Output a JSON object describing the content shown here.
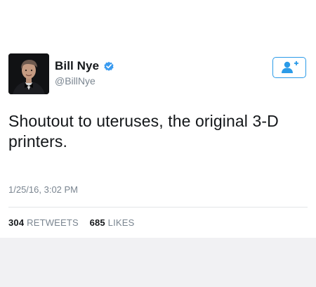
{
  "tweet": {
    "author": {
      "display_name": "Bill Nye",
      "handle": "@BillNye",
      "verified": true
    },
    "text": "Shoutout to uteruses, the original 3-D printers.",
    "timestamp": "1/25/16, 3:02 PM",
    "stats": {
      "retweets_count": "304",
      "retweets_label": "RETWEETS",
      "likes_count": "685",
      "likes_label": "LIKES"
    }
  },
  "icons": {
    "follow": "add-user-icon",
    "verified": "verified-badge-icon"
  },
  "colors": {
    "accent": "#2b9be8",
    "text": "#14171a",
    "muted": "#7a8590",
    "divider": "#e3e6e8"
  }
}
